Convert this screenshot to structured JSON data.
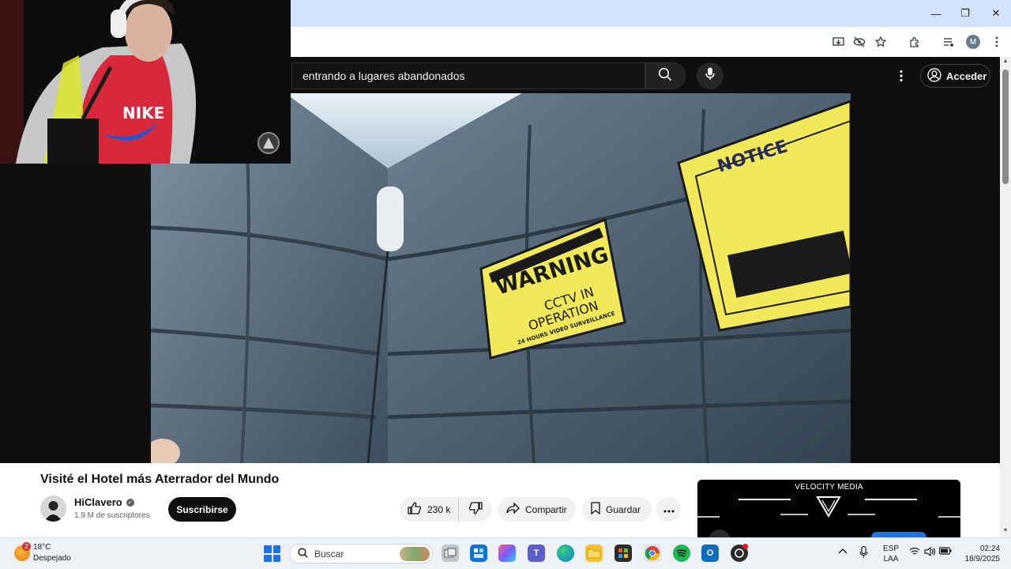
{
  "window": {
    "minimize_glyph": "—",
    "maximize_glyph": "❐",
    "close_glyph": "✕"
  },
  "browser": {
    "profile_initial": "M",
    "toolbar_icons": [
      "install-app-icon",
      "eye-off-icon",
      "bookmark-star-icon",
      "extensions-icon",
      "media-control-icon",
      "profile-icon",
      "menu-icon"
    ]
  },
  "youtube": {
    "search": {
      "value": "entrando a lugares abandonados"
    },
    "signin_label": "Acceder",
    "video": {
      "title": "Visité el Hotel más Aterrador del Mundo",
      "channel": "HiClavero",
      "subscribers": "1.9 M de suscriptores",
      "subscribe_label": "Suscribirse",
      "likes": "230 k",
      "share_label": "Compartir",
      "save_label": "Guardar"
    },
    "scene_signs": {
      "warning_line1": "WARNING",
      "warning_line2": "CCTV IN",
      "warning_line3": "OPERATION",
      "warning_line4": "24 HOURS VIDEO SURVEILLANCE",
      "notice": "NOTICE"
    },
    "webcam_shirt_text": "NIKE",
    "ad": {
      "label": "VELOCITY MEDIA"
    }
  },
  "taskbar": {
    "weather": {
      "temp": "18°C",
      "condition": "Despejado",
      "badge": "2"
    },
    "search_placeholder": "Buscar",
    "lang_top": "ESP",
    "lang_bottom": "LAA",
    "time": "02:24",
    "date": "18/9/2025"
  },
  "colors": {
    "chrome_titlebar": "#d3e3fd",
    "youtube_bg": "#0f0f0f",
    "accent_blue": "#1a73e8",
    "warning_yellow": "#f1e85a"
  }
}
